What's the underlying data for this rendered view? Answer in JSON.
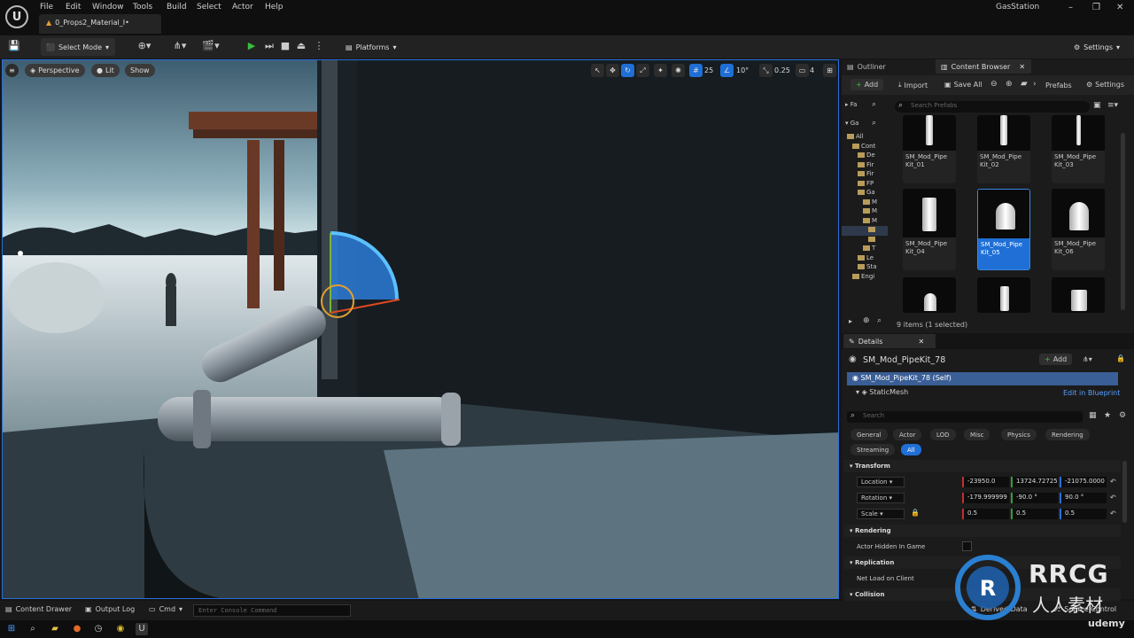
{
  "app": {
    "project_name": "GasStation",
    "doc_tab": "0_Props2_Material_I•"
  },
  "menu": [
    "File",
    "Edit",
    "Window",
    "Tools",
    "Build",
    "Select",
    "Actor",
    "Help"
  ],
  "toolbar": {
    "select_mode": "Select Mode",
    "platforms": "Platforms",
    "settings": "Settings"
  },
  "viewport": {
    "perspective": "Perspective",
    "lit": "Lit",
    "show": "Show",
    "grid_snap": "25",
    "angle_snap": "10°",
    "scale_snap": "0.25",
    "camera_speed": "4"
  },
  "outliner_tab": "Outliner",
  "content_browser": {
    "tab": "Content Browser",
    "add": "Add",
    "import": "Import",
    "save_all": "Save All",
    "path": "Prefabs",
    "settings": "Settings",
    "search_placeholder": "Search Prefabs",
    "favorites": "Fa",
    "source": "Ga",
    "tree": [
      "All",
      "Cont",
      "De",
      "Fir",
      "Fir",
      "FP",
      "Ga",
      "M",
      "M",
      "M",
      "",
      "",
      "T",
      "Le",
      "Sta",
      "Engi"
    ],
    "assets": [
      {
        "name": "SM_Mod_Pipe Kit_01"
      },
      {
        "name": "SM_Mod_Pipe Kit_02"
      },
      {
        "name": "SM_Mod_Pipe Kit_03"
      },
      {
        "name": "SM_Mod_Pipe Kit_04"
      },
      {
        "name": "SM_Mod_Pipe Kit_05"
      },
      {
        "name": "SM_Mod_Pipe Kit_06"
      }
    ],
    "status": "9 items (1 selected)"
  },
  "details": {
    "tab": "Details",
    "actor_name": "SM_Mod_PipeKit_78",
    "add": "Add",
    "self_row": "SM_Mod_PipeKit_78 (Self)",
    "component": "StaticMesh",
    "edit_blueprint": "Edit in Blueprint",
    "search_placeholder": "Search",
    "filters": [
      "General",
      "Actor",
      "LOD",
      "Misc",
      "Physics",
      "Rendering"
    ],
    "filters2": [
      "Streaming",
      "All"
    ],
    "transform_header": "Transform",
    "location_label": "Location",
    "location": [
      "-23950.0",
      "13724.72725",
      "-21075.0000"
    ],
    "rotation_label": "Rotation",
    "rotation": [
      "-179.999999",
      "-90.0 °",
      "90.0 °"
    ],
    "scale_label": "Scale",
    "scale": [
      "0.5",
      "0.5",
      "0.5"
    ],
    "rendering_header": "Rendering",
    "actor_hidden": "Actor Hidden In Game",
    "replication_header": "Replication",
    "net_load": "Net Load on Client",
    "collision_header": "Collision"
  },
  "bottom": {
    "content_drawer": "Content Drawer",
    "output_log": "Output Log",
    "cmd": "Cmd",
    "console_placeholder": "Enter Console Command",
    "derived_data": "Derived Data",
    "source_control": "Source Control"
  },
  "watermark": {
    "brand": "RRCG",
    "sub": "人人素材",
    "udemy": "udemy"
  }
}
